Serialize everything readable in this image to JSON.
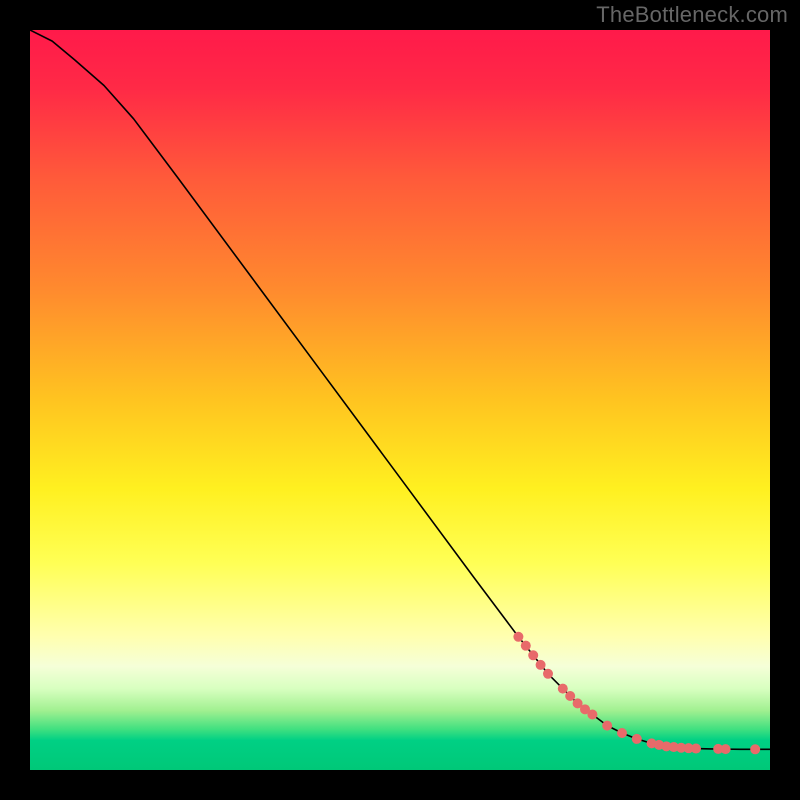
{
  "watermark": "TheBottleneck.com",
  "chart_data": {
    "type": "line",
    "title": "",
    "xlabel": "",
    "ylabel": "",
    "xlim": [
      0,
      100
    ],
    "ylim": [
      0,
      100
    ],
    "gradient_stops": [
      {
        "offset": 0.0,
        "color": "#ff1a4a"
      },
      {
        "offset": 0.08,
        "color": "#ff2a46"
      },
      {
        "offset": 0.2,
        "color": "#ff5a3a"
      },
      {
        "offset": 0.35,
        "color": "#ff8a2e"
      },
      {
        "offset": 0.5,
        "color": "#ffc420"
      },
      {
        "offset": 0.62,
        "color": "#fff020"
      },
      {
        "offset": 0.72,
        "color": "#ffff55"
      },
      {
        "offset": 0.82,
        "color": "#ffffb0"
      },
      {
        "offset": 0.86,
        "color": "#f5ffd8"
      },
      {
        "offset": 0.89,
        "color": "#d8ffc0"
      },
      {
        "offset": 0.92,
        "color": "#a0f090"
      },
      {
        "offset": 0.945,
        "color": "#40e080"
      },
      {
        "offset": 0.96,
        "color": "#00d084"
      },
      {
        "offset": 1.0,
        "color": "#00c878"
      }
    ],
    "series": [
      {
        "name": "bottleneck-curve",
        "color": "#000000",
        "x": [
          0,
          3,
          6,
          10,
          14,
          20,
          30,
          40,
          50,
          60,
          66,
          70,
          74,
          78,
          80,
          82,
          84,
          86,
          88,
          90,
          92,
          94,
          96,
          98,
          100
        ],
        "y": [
          100,
          98.5,
          96,
          92.5,
          88,
          80,
          66.5,
          53,
          39.5,
          26,
          18,
          13,
          9,
          6,
          5,
          4.2,
          3.6,
          3.2,
          3.0,
          2.9,
          2.85,
          2.82,
          2.8,
          2.8,
          2.8
        ]
      }
    ],
    "markers": {
      "name": "highlight-points",
      "color": "#e86a6a",
      "radius": 5,
      "points": [
        {
          "x": 66,
          "y": 18.0
        },
        {
          "x": 67,
          "y": 16.8
        },
        {
          "x": 68,
          "y": 15.5
        },
        {
          "x": 69,
          "y": 14.2
        },
        {
          "x": 70,
          "y": 13.0
        },
        {
          "x": 72,
          "y": 11.0
        },
        {
          "x": 73,
          "y": 10.0
        },
        {
          "x": 74,
          "y": 9.0
        },
        {
          "x": 75,
          "y": 8.2
        },
        {
          "x": 76,
          "y": 7.5
        },
        {
          "x": 78,
          "y": 6.0
        },
        {
          "x": 80,
          "y": 5.0
        },
        {
          "x": 82,
          "y": 4.2
        },
        {
          "x": 84,
          "y": 3.6
        },
        {
          "x": 85,
          "y": 3.4
        },
        {
          "x": 86,
          "y": 3.2
        },
        {
          "x": 87,
          "y": 3.1
        },
        {
          "x": 88,
          "y": 3.0
        },
        {
          "x": 89,
          "y": 2.95
        },
        {
          "x": 90,
          "y": 2.9
        },
        {
          "x": 93,
          "y": 2.85
        },
        {
          "x": 94,
          "y": 2.82
        },
        {
          "x": 98,
          "y": 2.8
        }
      ]
    }
  }
}
